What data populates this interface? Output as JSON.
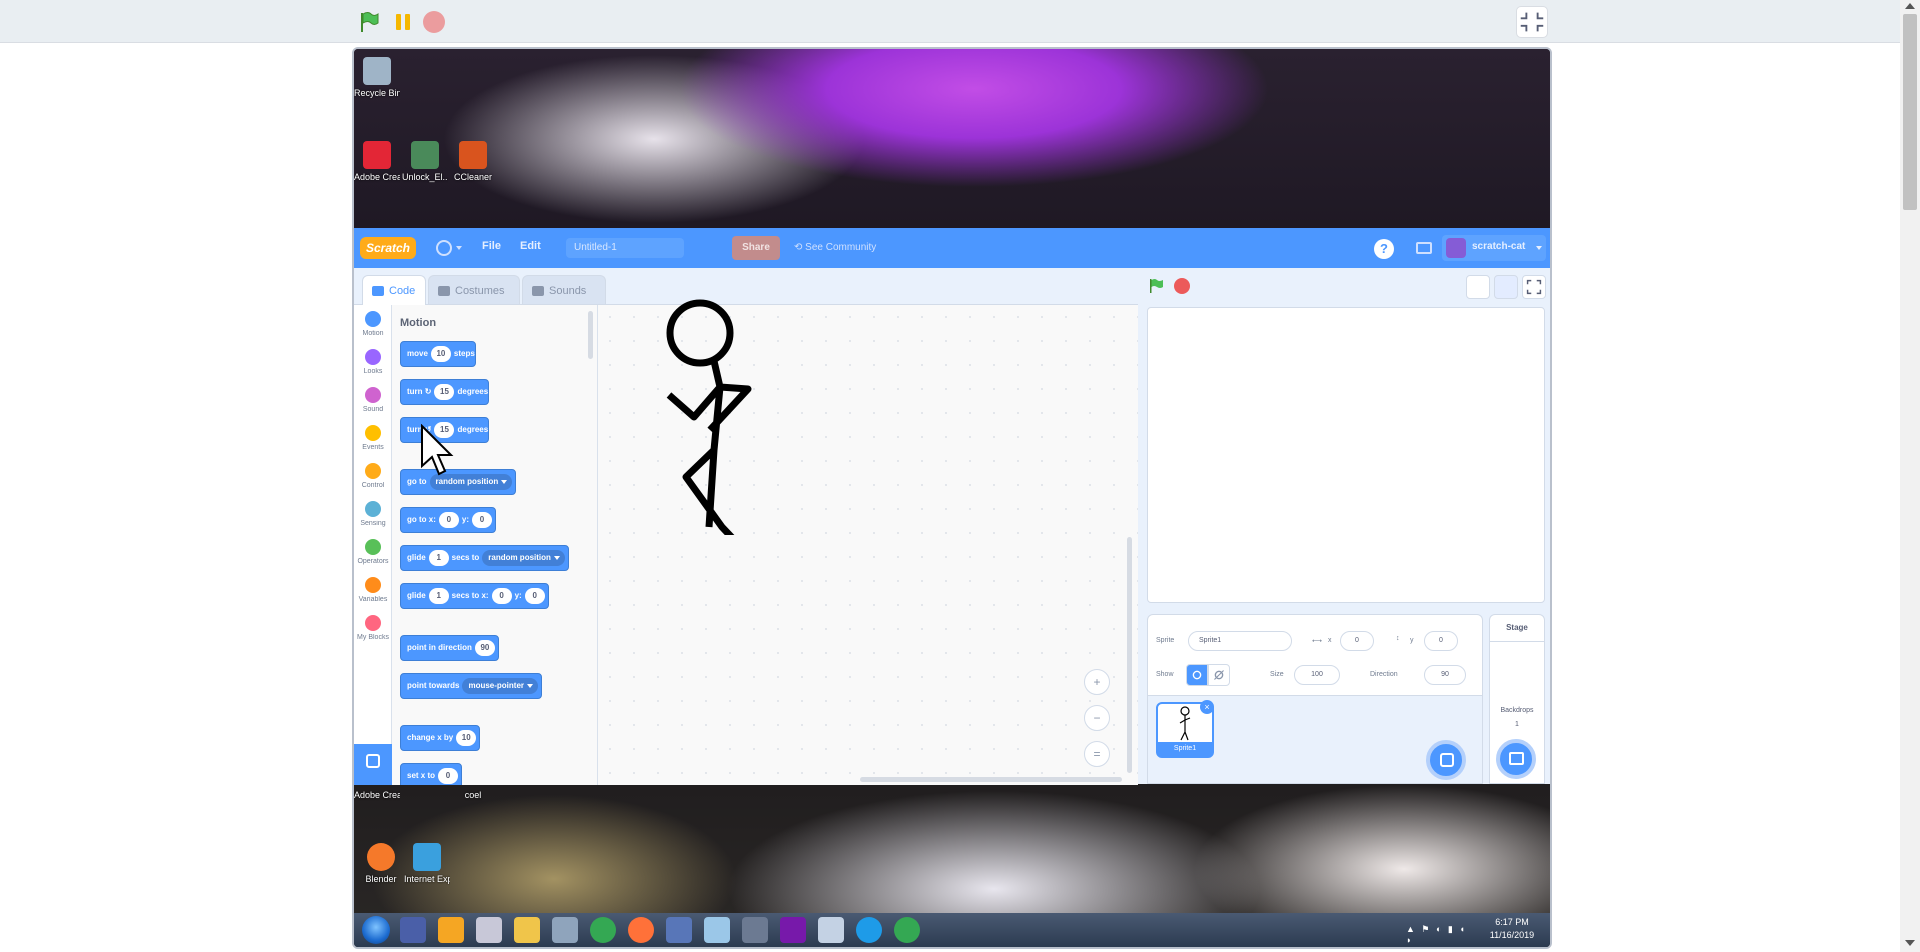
{
  "player": {
    "green_flag_icon": "green-flag-icon",
    "pause_icon": "pause-icon",
    "stop_icon": "stop-sign-icon",
    "exit_fullscreen_icon": "exit-fullscreen-icon"
  },
  "desktop": {
    "icons_top": [
      {
        "label": "Recycle Bin",
        "color": "#9fb4c7"
      },
      {
        "label": "Adobe Creative Cloud",
        "color": "#e32636"
      },
      {
        "label": "Unlock_El...",
        "color": "#4a8a5a"
      },
      {
        "label": "CCleaner",
        "color": "#d9541e"
      }
    ],
    "icons_bottom": [
      {
        "label": "Blender",
        "color": "#f5792a"
      },
      {
        "label": "Internet Explorer",
        "color": "#3aa0de"
      }
    ],
    "bottom_labels": [
      "Adobe Creative Cloud",
      "coel"
    ],
    "taskbar": {
      "clock_time": "6:17 PM",
      "clock_date": "11/16/2019",
      "tray": "▲ ⚑ ◐ ▮ ◖ ◗"
    }
  },
  "scratch": {
    "logo": "Scratch",
    "menu": {
      "file": "File",
      "edit": "Edit"
    },
    "project_title": "Untitled-1",
    "share": "Share",
    "see_community": "See Community",
    "help": "?",
    "account_name": "scratch-cat",
    "tabs": {
      "code": "Code",
      "costumes": "Costumes",
      "sounds": "Sounds"
    },
    "categories": [
      {
        "label": "Motion",
        "color": "#4c97ff"
      },
      {
        "label": "Looks",
        "color": "#9966ff"
      },
      {
        "label": "Sound",
        "color": "#cf63cf"
      },
      {
        "label": "Events",
        "color": "#ffbf00"
      },
      {
        "label": "Control",
        "color": "#ffab19"
      },
      {
        "label": "Sensing",
        "color": "#5cb1d6"
      },
      {
        "label": "Operators",
        "color": "#59c059"
      },
      {
        "label": "Variables",
        "color": "#ff8c1a"
      },
      {
        "label": "My Blocks",
        "color": "#ff6680"
      }
    ],
    "palette_title": "Motion",
    "blocks": {
      "move": {
        "pre": "move",
        "val": "10",
        "post": "steps"
      },
      "turn_right": {
        "pre": "turn ↻",
        "val": "15",
        "post": "degrees"
      },
      "turn_left": {
        "pre": "turn ↺",
        "val": "15",
        "post": "degrees"
      },
      "go_to": {
        "pre": "go to",
        "drop": "random position"
      },
      "go_to_xy": {
        "pre": "go to x:",
        "x": "0",
        "mid": "y:",
        "y": "0"
      },
      "glide_to": {
        "pre": "glide",
        "val": "1",
        "mid": "secs to",
        "drop": "random position"
      },
      "glide_xy": {
        "pre": "glide",
        "val": "1",
        "mid": "secs to x:",
        "x": "0",
        "mid2": "y:",
        "y": "0"
      },
      "point_dir": {
        "pre": "point in direction",
        "val": "90"
      },
      "point_towards": {
        "pre": "point towards",
        "drop": "mouse-pointer"
      },
      "change_x": {
        "pre": "change x by",
        "val": "10"
      },
      "set_x": {
        "pre": "set x to",
        "val": "0"
      }
    },
    "zoom": {
      "in": "+",
      "out": "−",
      "reset": "="
    },
    "sprite_info": {
      "sprite_label": "Sprite",
      "sprite_name": "Sprite1",
      "x_label": "x",
      "x_value": "0",
      "y_label": "y",
      "y_value": "0",
      "show_label": "Show",
      "size_label": "Size",
      "size_value": "100",
      "direction_label": "Direction",
      "direction_value": "90"
    },
    "sprite_thumb_label": "Sprite1",
    "stage_panel": {
      "title": "Stage",
      "backdrops_label": "Backdrops",
      "backdrops_count": "1"
    }
  }
}
